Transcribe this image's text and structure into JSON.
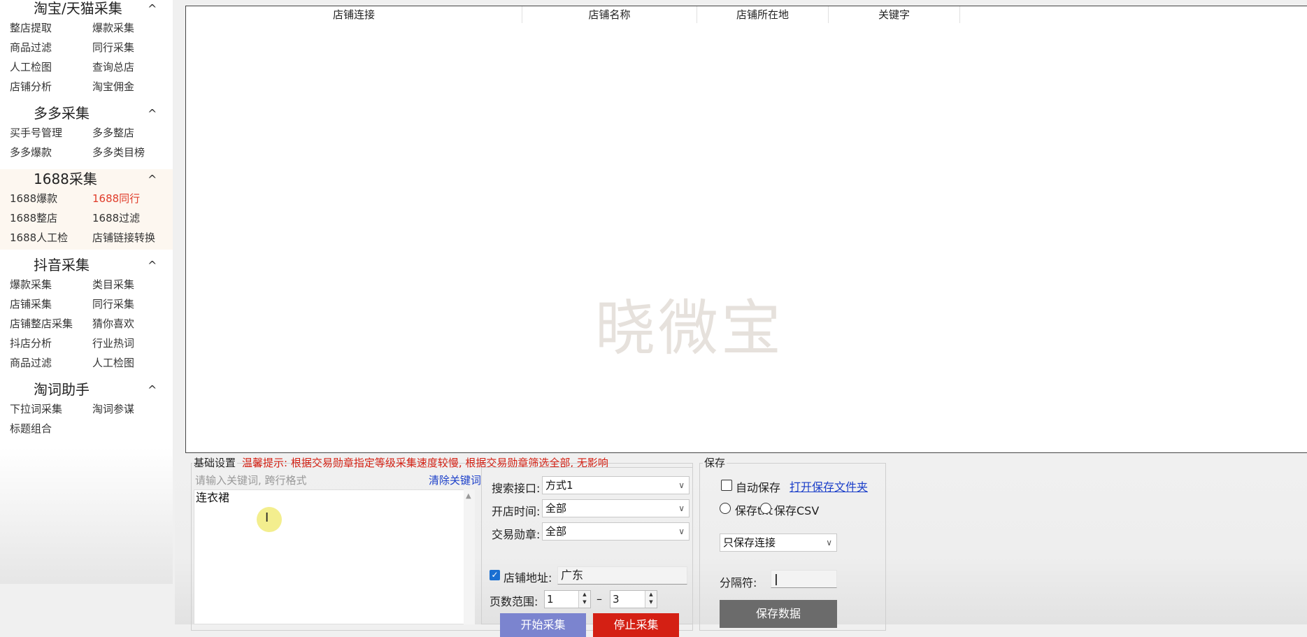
{
  "sidebar": {
    "sections": [
      {
        "title": "淘宝/天猫采集",
        "items": [
          "整店提取",
          "爆款采集",
          "商品过滤",
          "同行采集",
          "人工检图",
          "查询总店",
          "店铺分析",
          "淘宝佣金"
        ]
      },
      {
        "title": "多多采集",
        "items": [
          "买手号管理",
          "多多整店",
          "多多爆款",
          "多多类目榜"
        ]
      },
      {
        "title": "1688采集",
        "items": [
          "1688爆款",
          "1688同行",
          "1688整店",
          "1688过滤",
          "1688人工检",
          "店铺链接转换"
        ]
      },
      {
        "title": "抖音采集",
        "items": [
          "爆款采集",
          "类目采集",
          "店铺采集",
          "同行采集",
          "店铺整店采集",
          "猜你喜欢",
          "抖店分析",
          "行业热词",
          "商品过滤",
          "人工检图"
        ]
      },
      {
        "title": "淘词助手",
        "items": [
          "下拉词采集",
          "淘词参谋",
          "标题组合"
        ]
      }
    ],
    "chevron": "^",
    "active_item": "1688同行"
  },
  "table": {
    "columns": [
      "店铺连接",
      "店铺名称",
      "店铺所在地",
      "关键字"
    ],
    "rows": [],
    "watermark": "晓微宝"
  },
  "basic": {
    "title": "基础设置",
    "tip": "温馨提示: 根据交易勋章指定等级采集速度较慢, 根据交易勋章筛选全部, 无影响",
    "keyword_placeholder": "请输入关键词, 跨行格式",
    "clear_label": "清除关键词",
    "keyword_value": "连衣裙"
  },
  "filters": {
    "search_api_label": "搜索接口:",
    "search_api_value": "方式1",
    "open_time_label": "开店时间:",
    "open_time_value": "全部",
    "medal_label": "交易勋章:",
    "medal_value": "全部",
    "address_label": "店铺地址:",
    "address_value": "广东",
    "address_checked": true,
    "page_range_label": "页数范围:",
    "page_from": "1",
    "page_to": "3",
    "dash": "–",
    "start_button": "开始采集",
    "stop_button": "停止采集"
  },
  "save": {
    "title": "保存",
    "auto_save_label": "自动保存",
    "open_folder_link": "打开保存文件夹",
    "txt_label": "保存txt",
    "csv_label": "保存CSV",
    "mode_value": "只保存连接",
    "separator_label": "分隔符:",
    "separator_value": "|",
    "save_button": "保存数据"
  },
  "colors": {
    "accent_red": "#e03c2a",
    "link_blue": "#1a3ec9",
    "start_button": "#7b84cf",
    "stop_button": "#d42014",
    "save_button": "#6b6b6b"
  }
}
